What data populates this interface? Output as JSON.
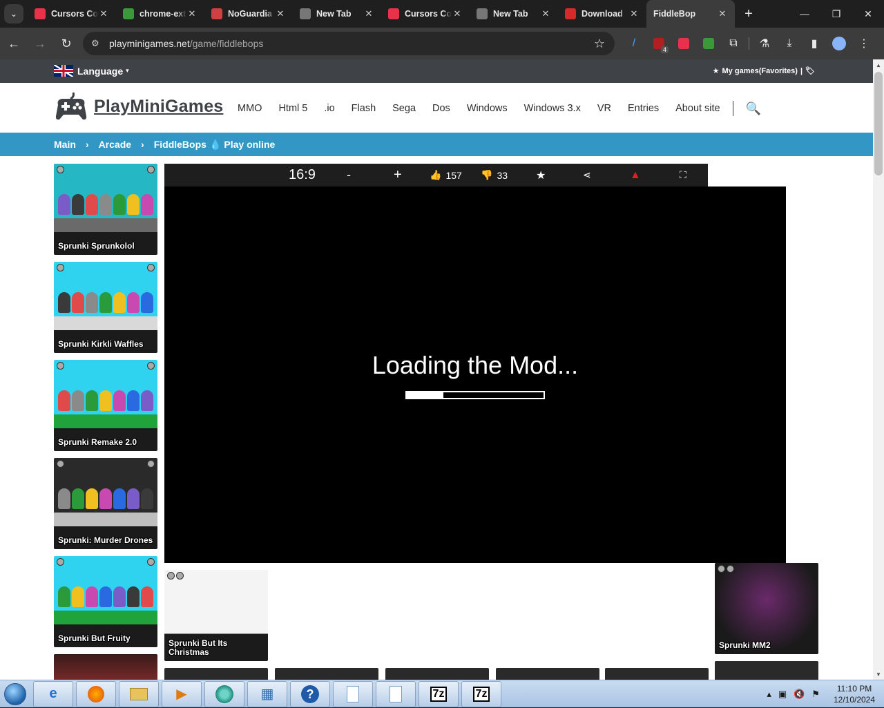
{
  "browser": {
    "tabs": [
      {
        "title": "Cursors Co",
        "fav_color": "#e8324a"
      },
      {
        "title": "chrome-ext",
        "fav_color": "#3a9a3a"
      },
      {
        "title": "NoGuardia",
        "fav_color": "#d04040"
      },
      {
        "title": "New Tab",
        "fav_color": "#777777"
      },
      {
        "title": "Cursors Co",
        "fav_color": "#e8324a"
      },
      {
        "title": "New Tab",
        "fav_color": "#777777"
      },
      {
        "title": "Download",
        "fav_color": "#d42a2a"
      },
      {
        "title": "FiddleBop",
        "fav_color": "#3c3c3c",
        "active": true
      }
    ],
    "new_tab": "+",
    "url_host": "playminigames.net",
    "url_path": "/game/fiddlebops",
    "ext_badge": "4"
  },
  "site": {
    "language_label": "Language",
    "favorites_label": "My games(Favorites)",
    "logo_text": "PlayMiniGames",
    "nav": [
      "MMO",
      "Html 5",
      ".io",
      "Flash",
      "Sega",
      "Dos",
      "Windows",
      "Windows 3.x",
      "VR",
      "Entries",
      "About site"
    ],
    "breadcrumbs": {
      "main": "Main",
      "section": "Arcade",
      "game": "FiddleBops",
      "action": "Play online"
    }
  },
  "game": {
    "ratio": "16:9",
    "minus": "-",
    "plus": "+",
    "likes": "157",
    "dislikes": "33",
    "loading_text": "Loading the Mod...",
    "progress": 0.27
  },
  "sidebar_games": [
    {
      "title": "Sprunki Sprunkolol",
      "bg": "#25b8c4",
      "floor": "#6a6a6a"
    },
    {
      "title": "Sprunki Kirkli Waffles",
      "bg": "#2fd3f0",
      "floor": "#d9d9d9"
    },
    {
      "title": "Sprunki Remake 2.0",
      "bg": "#2fd3f0",
      "floor": "#1fa33a"
    },
    {
      "title": "Sprunki: Murder Drones",
      "bg": "#2a2a2a",
      "floor": "#bfbfbf"
    },
    {
      "title": "Sprunki But Fruity",
      "bg": "#2fd3f0",
      "floor": "#1fa33a"
    }
  ],
  "bottom_games": [
    {
      "title": "Sprunki But Its Christmas",
      "bg": "#e9e9e9"
    },
    {
      "title": "Sprunki MM2",
      "bg": "#1a1a1a"
    }
  ],
  "taskbar": {
    "time": "11:10 PM",
    "date": "12/10/2024"
  }
}
